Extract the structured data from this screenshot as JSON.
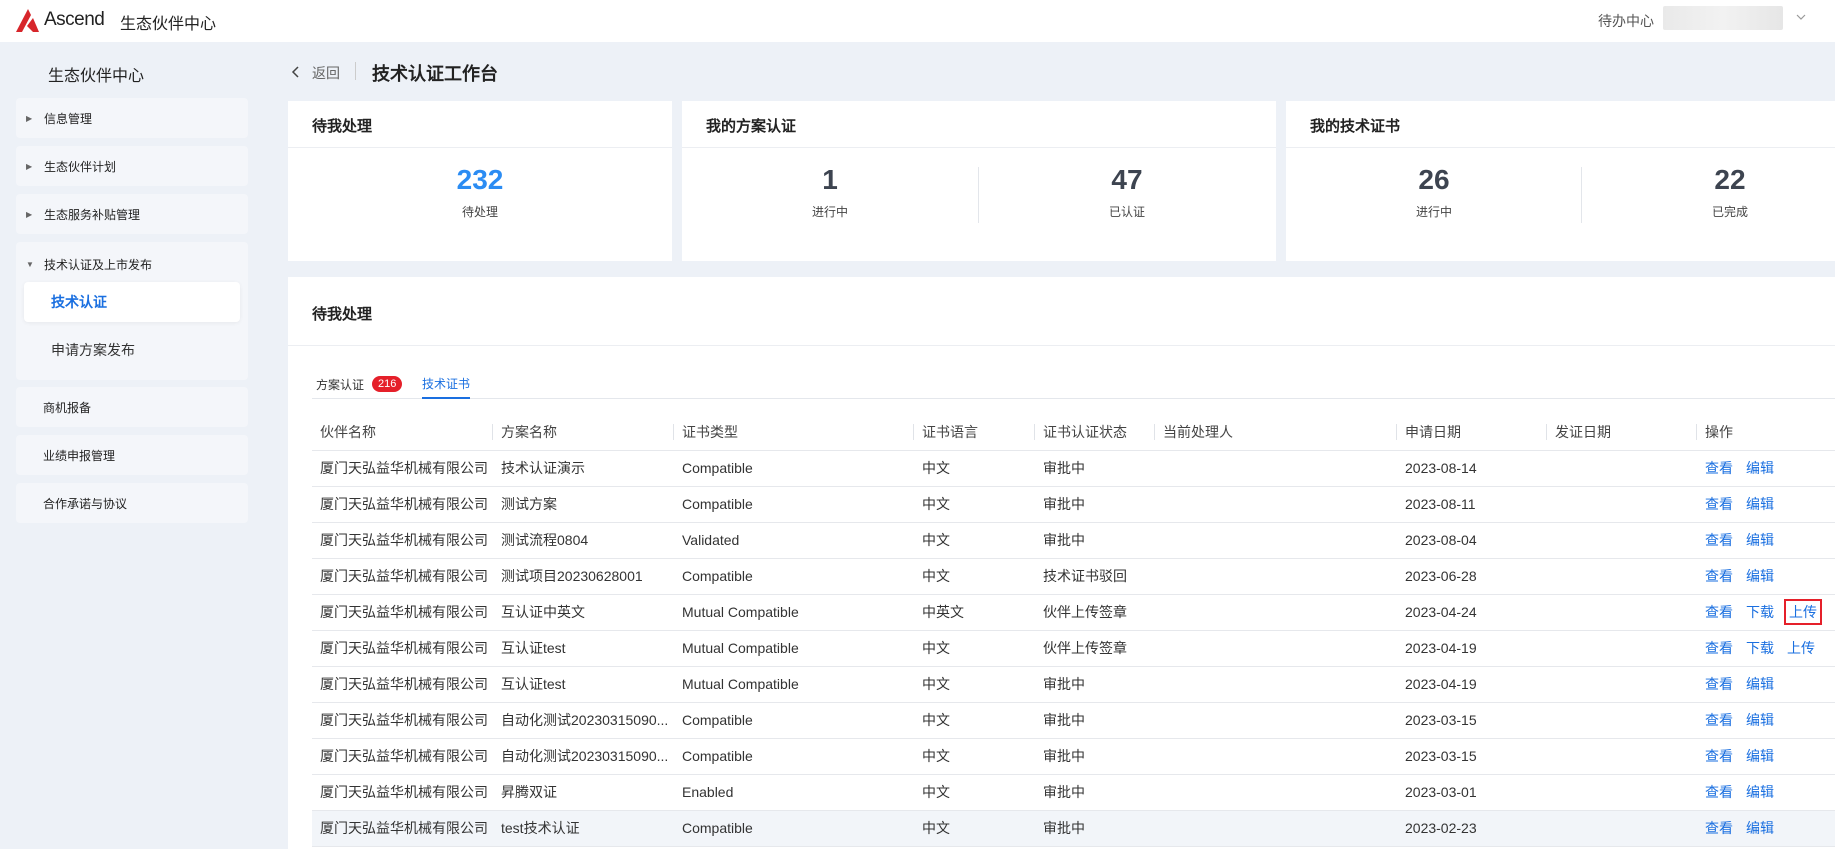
{
  "app": {
    "logo_text": "Ascend",
    "title": "生态伙伴中心",
    "todo_center": "待办中心"
  },
  "sidebar": {
    "title": "生态伙伴中心",
    "groups": [
      {
        "label": "信息管理"
      },
      {
        "label": "生态伙伴计划"
      },
      {
        "label": "生态服务补贴管理"
      },
      {
        "label": "技术认证及上市发布",
        "children": [
          {
            "label": "技术认证",
            "active": true
          },
          {
            "label": "申请方案发布"
          }
        ]
      },
      {
        "label": "商机报备"
      },
      {
        "label": "业绩申报管理"
      },
      {
        "label": "合作承诺与协议"
      }
    ]
  },
  "header": {
    "back_label": "返回",
    "page_title": "技术认证工作台"
  },
  "cards": {
    "pending": {
      "title": "待我处理",
      "value": "232",
      "label": "待处理"
    },
    "solutions": {
      "title": "我的方案认证",
      "in_progress": "1",
      "in_progress_label": "进行中",
      "certified": "47",
      "certified_label": "已认证"
    },
    "certificates": {
      "title": "我的技术证书",
      "in_progress": "26",
      "in_progress_label": "进行中",
      "completed": "22",
      "completed_label": "已完成"
    }
  },
  "panel": {
    "title": "待我处理",
    "tabs": [
      {
        "label": "方案认证",
        "badge": "216"
      },
      {
        "label": "技术证书",
        "active": true
      }
    ],
    "columns": [
      "伙伴名称",
      "方案名称",
      "证书类型",
      "证书语言",
      "证书认证状态",
      "当前处理人",
      "申请日期",
      "发证日期",
      "操作"
    ],
    "rows": [
      {
        "partner": "厦门天弘益华机械有限公司",
        "solution": "技术认证演示",
        "type": "Compatible",
        "lang": "中文",
        "status": "审批中",
        "handler": "",
        "apply_date": "2023-08-14",
        "issue_date": "",
        "ops": [
          "查看",
          "编辑"
        ]
      },
      {
        "partner": "厦门天弘益华机械有限公司",
        "solution": "测试方案",
        "type": "Compatible",
        "lang": "中文",
        "status": "审批中",
        "handler": "",
        "apply_date": "2023-08-11",
        "issue_date": "",
        "ops": [
          "查看",
          "编辑"
        ]
      },
      {
        "partner": "厦门天弘益华机械有限公司",
        "solution": "测试流程0804",
        "type": "Validated",
        "lang": "中文",
        "status": "审批中",
        "handler": "",
        "apply_date": "2023-08-04",
        "issue_date": "",
        "ops": [
          "查看",
          "编辑"
        ]
      },
      {
        "partner": "厦门天弘益华机械有限公司",
        "solution": "测试项目20230628001",
        "type": "Compatible",
        "lang": "中文",
        "status": "技术证书驳回",
        "handler": "",
        "apply_date": "2023-06-28",
        "issue_date": "",
        "ops": [
          "查看",
          "编辑"
        ]
      },
      {
        "partner": "厦门天弘益华机械有限公司",
        "solution": "互认证中英文",
        "type": "Mutual Compatible",
        "lang": "中英文",
        "status": "伙伴上传签章",
        "handler": "",
        "apply_date": "2023-04-24",
        "issue_date": "",
        "ops": [
          "查看",
          "下载",
          "上传"
        ]
      },
      {
        "partner": "厦门天弘益华机械有限公司",
        "solution": "互认证test",
        "type": "Mutual Compatible",
        "lang": "中文",
        "status": "伙伴上传签章",
        "handler": "",
        "apply_date": "2023-04-19",
        "issue_date": "",
        "ops": [
          "查看",
          "下载",
          "上传"
        ]
      },
      {
        "partner": "厦门天弘益华机械有限公司",
        "solution": "互认证test",
        "type": "Mutual Compatible",
        "lang": "中文",
        "status": "审批中",
        "handler": "",
        "apply_date": "2023-04-19",
        "issue_date": "",
        "ops": [
          "查看",
          "编辑"
        ]
      },
      {
        "partner": "厦门天弘益华机械有限公司",
        "solution": "自动化测试20230315090...",
        "type": "Compatible",
        "lang": "中文",
        "status": "审批中",
        "handler": "",
        "apply_date": "2023-03-15",
        "issue_date": "",
        "ops": [
          "查看",
          "编辑"
        ]
      },
      {
        "partner": "厦门天弘益华机械有限公司",
        "solution": "自动化测试20230315090...",
        "type": "Compatible",
        "lang": "中文",
        "status": "审批中",
        "handler": "",
        "apply_date": "2023-03-15",
        "issue_date": "",
        "ops": [
          "查看",
          "编辑"
        ]
      },
      {
        "partner": "厦门天弘益华机械有限公司",
        "solution": "昇腾双证",
        "type": "Enabled",
        "lang": "中文",
        "status": "审批中",
        "handler": "",
        "apply_date": "2023-03-01",
        "issue_date": "",
        "ops": [
          "查看",
          "编辑"
        ]
      },
      {
        "partner": "厦门天弘益华机械有限公司",
        "solution": "test技术认证",
        "type": "Compatible",
        "lang": "中文",
        "status": "审批中",
        "handler": "",
        "apply_date": "2023-02-23",
        "issue_date": "",
        "ops": [
          "查看",
          "编辑"
        ]
      }
    ]
  },
  "colors": {
    "accent": "#1a6fe0",
    "stat_blue": "#2b8cf3",
    "badge_red": "#e5202a",
    "logo_red": "#d7262b"
  }
}
